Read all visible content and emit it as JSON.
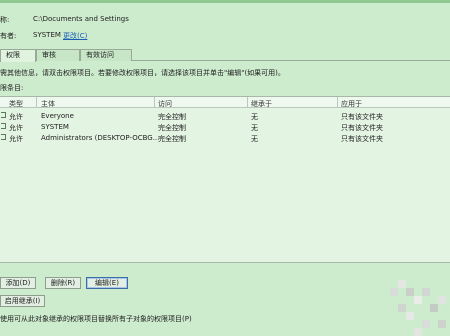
{
  "header": {
    "name_label": "称:",
    "name_value": "C:\\Documents and Settings",
    "owner_label": "有者:",
    "owner_value": "SYSTEM",
    "owner_change_link": "更改(C)"
  },
  "tabs": [
    {
      "label": "权限"
    },
    {
      "label": "审核"
    },
    {
      "label": "有效访问"
    }
  ],
  "info_text": "需其他信息，请双击权限项目。若要修改权限项目，请选择该项目并单击\"编辑\"(如果可用)。",
  "entries_label": "限条目:",
  "table": {
    "headers": [
      "类型",
      "主体",
      "访问",
      "继承于",
      "应用于"
    ],
    "rows": [
      {
        "type": "允许",
        "principal": "Everyone",
        "access": "完全控制",
        "inherited": "无",
        "applies": "只有该文件夹"
      },
      {
        "type": "允许",
        "principal": "SYSTEM",
        "access": "完全控制",
        "inherited": "无",
        "applies": "只有该文件夹"
      },
      {
        "type": "允许",
        "principal": "Administrators (DESKTOP-OCBG...",
        "access": "完全控制",
        "inherited": "无",
        "applies": "只有该文件夹"
      }
    ]
  },
  "buttons": {
    "add": "添加(D)",
    "remove": "删除(R)",
    "edit": "编辑(E)",
    "inherit": "启用继承(I)"
  },
  "footnote": "使用可从此对象继承的权限项目替换所有子对象的权限项目(P)",
  "colors": {
    "background": "#cdebcd",
    "link": "#1a5fb4"
  }
}
